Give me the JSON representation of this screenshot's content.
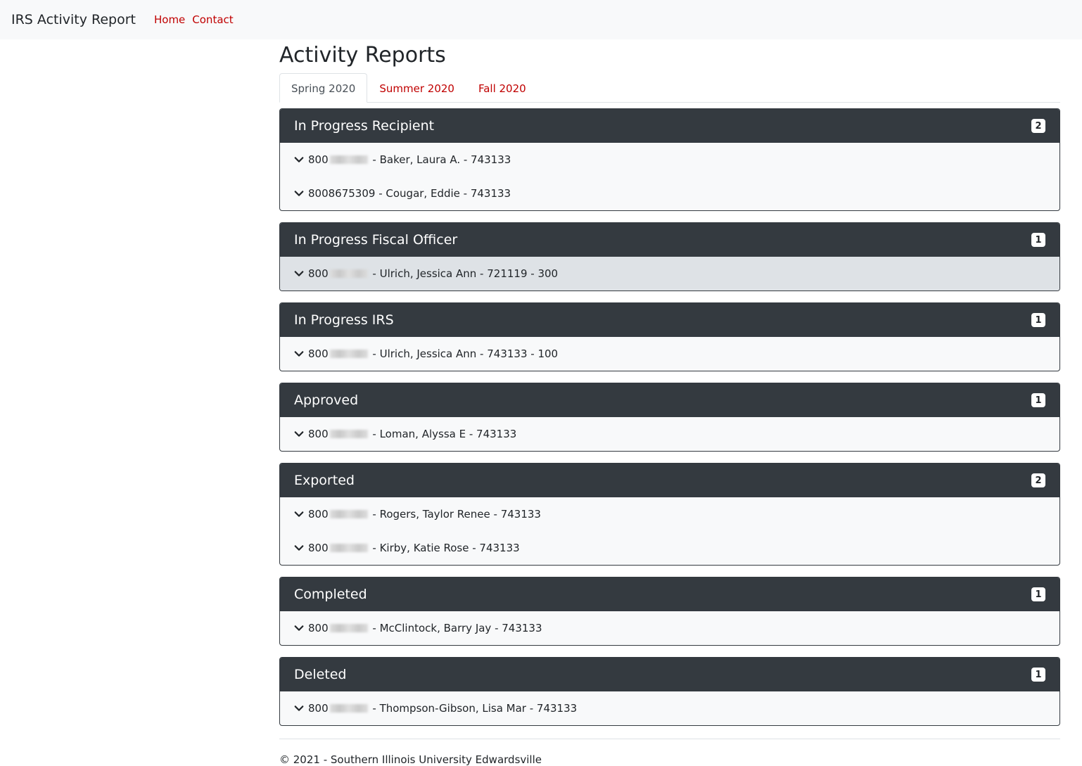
{
  "navbar": {
    "brand": "IRS Activity Report",
    "links": [
      "Home",
      "Contact"
    ]
  },
  "page": {
    "title": "Activity Reports"
  },
  "tabs": [
    {
      "label": "Spring 2020",
      "active": true
    },
    {
      "label": "Summer 2020",
      "active": false
    },
    {
      "label": "Fall 2020",
      "active": false
    }
  ],
  "sections": [
    {
      "title": "In Progress Recipient",
      "count": "2",
      "items": [
        {
          "prefix": "800",
          "redacted": true,
          "text": " - Baker, Laura A. - 743133"
        },
        {
          "prefix": "8008675309",
          "redacted": false,
          "text": " - Cougar, Eddie - 743133"
        }
      ]
    },
    {
      "title": "In Progress Fiscal Officer",
      "count": "1",
      "items": [
        {
          "prefix": "800",
          "redacted": true,
          "text": " - Ulrich, Jessica Ann - 721119 - 300",
          "hover": true
        }
      ]
    },
    {
      "title": "In Progress IRS",
      "count": "1",
      "items": [
        {
          "prefix": "800",
          "redacted": true,
          "text": " - Ulrich, Jessica Ann - 743133 - 100"
        }
      ]
    },
    {
      "title": "Approved",
      "count": "1",
      "items": [
        {
          "prefix": "800",
          "redacted": true,
          "text": " - Loman, Alyssa E - 743133"
        }
      ]
    },
    {
      "title": "Exported",
      "count": "2",
      "items": [
        {
          "prefix": "800",
          "redacted": true,
          "text": " - Rogers, Taylor Renee - 743133"
        },
        {
          "prefix": "800",
          "redacted": true,
          "text": " - Kirby, Katie Rose - 743133"
        }
      ]
    },
    {
      "title": "Completed",
      "count": "1",
      "items": [
        {
          "prefix": "800",
          "redacted": true,
          "text": " - McClintock, Barry Jay - 743133"
        }
      ]
    },
    {
      "title": "Deleted",
      "count": "1",
      "items": [
        {
          "prefix": "800",
          "redacted": true,
          "text": " - Thompson-Gibson, Lisa Mar - 743133"
        }
      ]
    }
  ],
  "footer": {
    "text": "© 2021 - Southern Illinois University Edwardsville"
  }
}
